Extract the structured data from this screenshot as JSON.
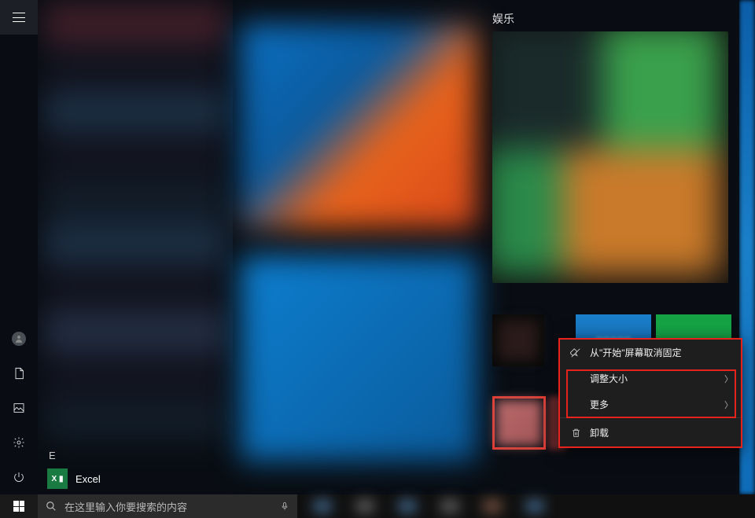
{
  "group_label": "娱乐",
  "section_letter": "E",
  "app_list": {
    "excel_label": "Excel",
    "excel_icon_text": "X ▮"
  },
  "context_menu": {
    "unpin": "从\"开始\"屏幕取消固定",
    "resize": "调整大小",
    "more": "更多",
    "uninstall": "卸载"
  },
  "taskbar": {
    "search_placeholder": "在这里输入你要搜索的内容"
  }
}
